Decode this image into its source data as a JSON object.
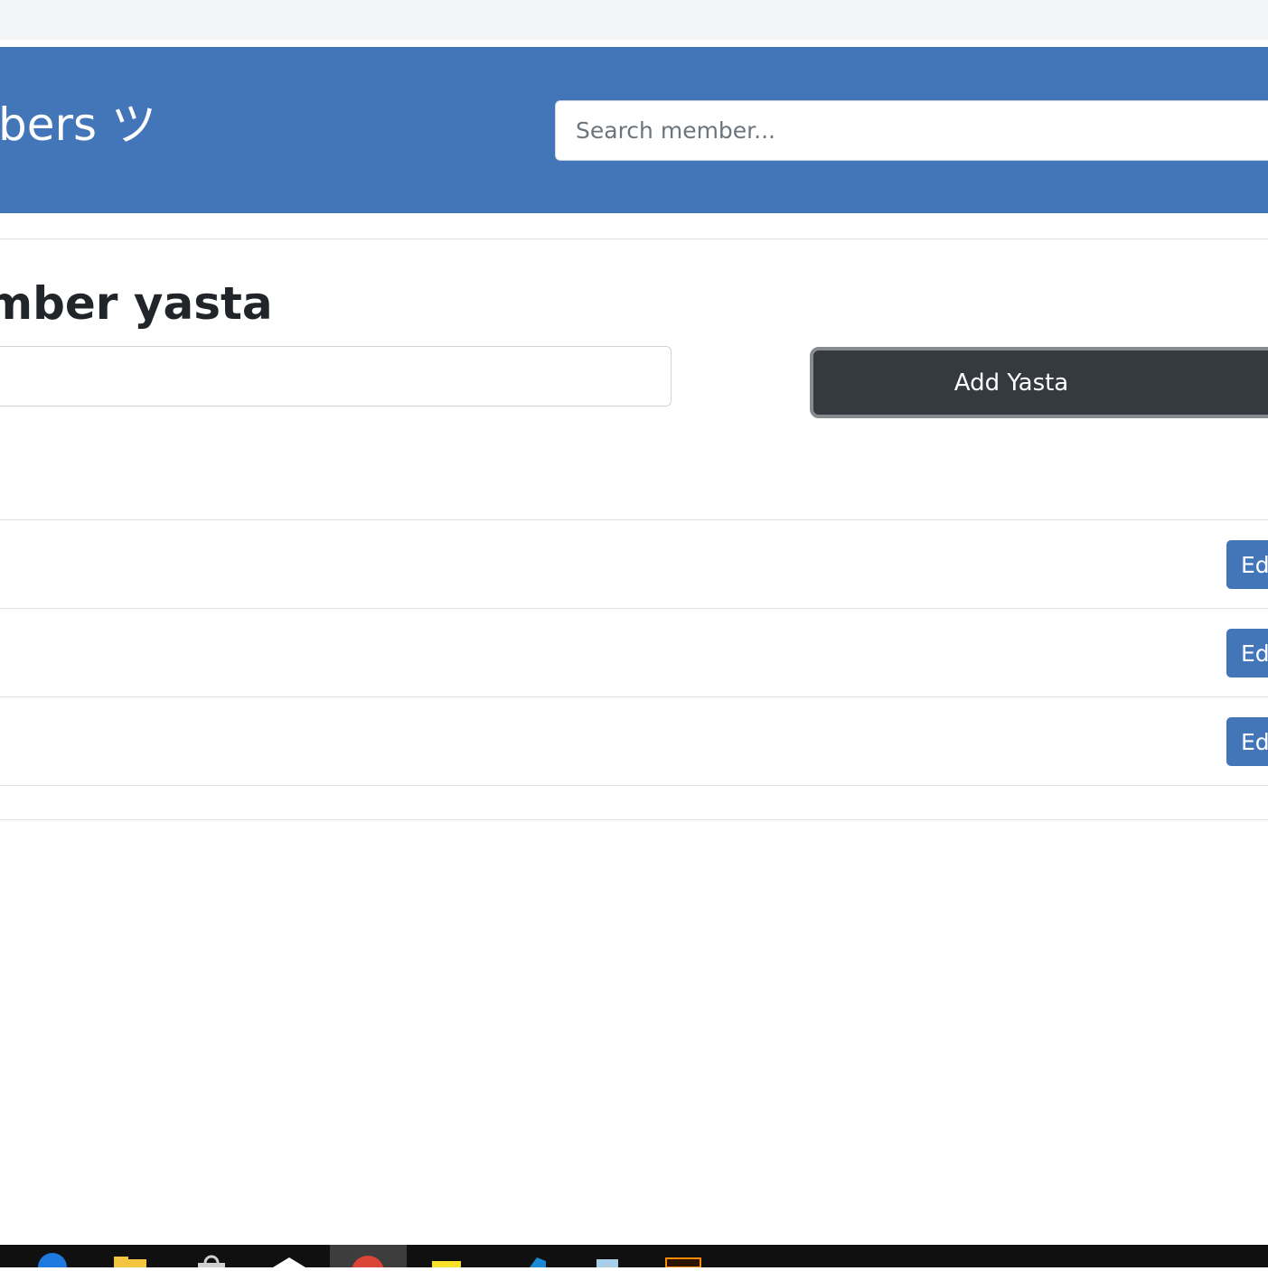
{
  "header": {
    "title": "bers ツ",
    "search_placeholder": "Search member..."
  },
  "form": {
    "title": "mber yasta",
    "input_value": "",
    "add_button_label": "Add Yasta"
  },
  "rows": [
    {
      "edit_label": "Edi"
    },
    {
      "edit_label": "Edi"
    },
    {
      "edit_label": "Edi"
    }
  ],
  "taskbar": {
    "icons": [
      "edge-icon",
      "file-explorer-icon",
      "snipping-tool-icon",
      "app-icon",
      "chrome-icon",
      "sticky-notes-icon",
      "vscode-icon",
      "notepad-icon",
      "illustrator-icon"
    ]
  },
  "colors": {
    "primary": "#4375b9",
    "dark_button": "#343a40",
    "taskbar": "#101010"
  }
}
